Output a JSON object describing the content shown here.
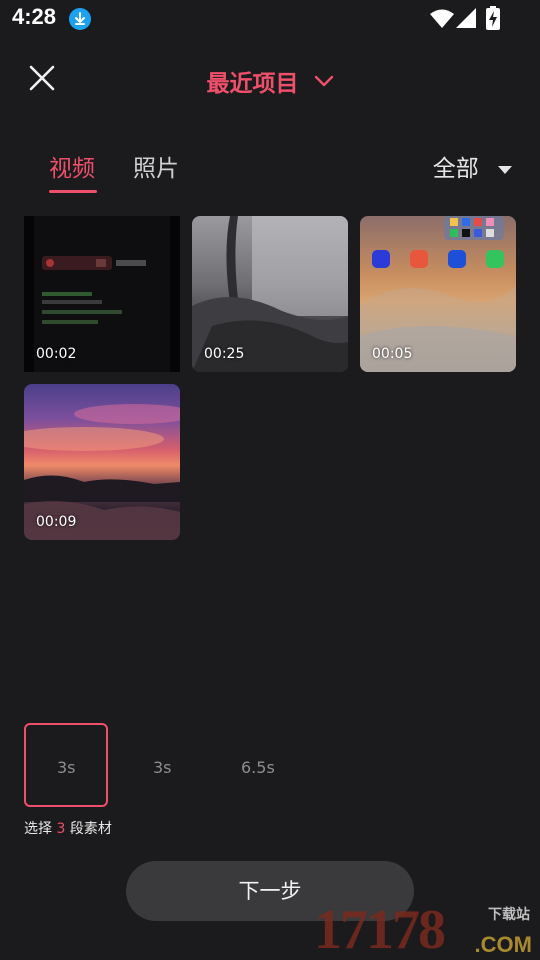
{
  "status_bar": {
    "time": "4:28",
    "icons": [
      "download-icon",
      "wifi-icon",
      "signal-icon",
      "battery-charging-icon"
    ]
  },
  "header": {
    "title": "最近项目",
    "title_color": "#ee4f6a"
  },
  "tabs": [
    {
      "label": "视频",
      "active": true
    },
    {
      "label": "照片",
      "active": false
    }
  ],
  "filter": {
    "label": "全部"
  },
  "media": [
    {
      "duration": "00:02"
    },
    {
      "duration": "00:25"
    },
    {
      "duration": "00:05"
    },
    {
      "duration": "00:09"
    }
  ],
  "selection": {
    "durations": [
      "3s",
      "3s",
      "6.5s"
    ],
    "caption_prefix": "选择",
    "count": "3",
    "caption_suffix": "段素材"
  },
  "next_button": {
    "label": "下一步"
  },
  "watermark": {
    "number": "17178",
    "domain": ".COM",
    "cn": "下载站"
  }
}
